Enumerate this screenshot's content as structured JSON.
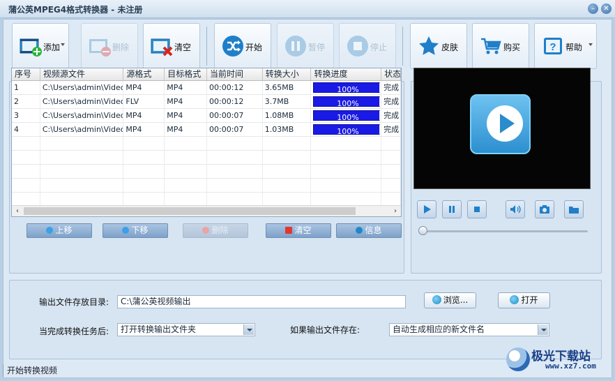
{
  "window": {
    "title": "蒲公英MPEG4格式转换器 - 未注册",
    "min_glyph": "–",
    "close_glyph": "✕"
  },
  "toolbar": {
    "add": "添加",
    "delete": "删除",
    "clear": "清空",
    "start": "开始",
    "pause": "暂停",
    "stop": "停止",
    "skin": "皮肤",
    "buy": "购买",
    "help": "帮助"
  },
  "table": {
    "headers": [
      "序号",
      "视频源文件",
      "源格式",
      "目标格式",
      "当前时间",
      "转换大小",
      "转换进度",
      "状态"
    ],
    "rows": [
      {
        "no": "1",
        "file": "C:\\Users\\admin\\Video...",
        "src": "MP4",
        "dst": "MP4",
        "time": "00:00:12",
        "size": "3.65MB",
        "progress": "100%",
        "progress_value": 1.0,
        "status": "完成"
      },
      {
        "no": "2",
        "file": "C:\\Users\\admin\\Video...",
        "src": "FLV",
        "dst": "MP4",
        "time": "00:00:12",
        "size": "3.7MB",
        "progress": "100%",
        "progress_value": 1.0,
        "status": "完成"
      },
      {
        "no": "3",
        "file": "C:\\Users\\admin\\Video...",
        "src": "MP4",
        "dst": "MP4",
        "time": "00:00:07",
        "size": "1.08MB",
        "progress": "100%",
        "progress_value": 1.0,
        "status": "完成"
      },
      {
        "no": "4",
        "file": "C:\\Users\\admin\\Video...",
        "src": "MP4",
        "dst": "MP4",
        "time": "00:00:07",
        "size": "1.03MB",
        "progress": "100%",
        "progress_value": 1.0,
        "status": "完成"
      }
    ],
    "scroll_left": "‹",
    "scroll_right": "›"
  },
  "list_buttons": {
    "up": "上移",
    "down": "下移",
    "delete": "删除",
    "clear": "清空",
    "info": "信息"
  },
  "output": {
    "dir_label": "输出文件存放目录:",
    "dir_value": "C:\\蒲公英视频输出",
    "browse": "浏览...",
    "open": "打开",
    "after_label": "当完成转换任务后:",
    "after_value": "打开转换输出文件夹",
    "exists_label": "如果输出文件存在:",
    "exists_value": "自动生成相应的新文件名"
  },
  "status_text": "开始转换视频",
  "watermark": {
    "brand": "极光下载站",
    "url": "www.xz7.com"
  },
  "colors": {
    "progress": "#1a1ae6",
    "accent": "#2d8fcf",
    "toolbar_blue": "#1f7fc9"
  }
}
